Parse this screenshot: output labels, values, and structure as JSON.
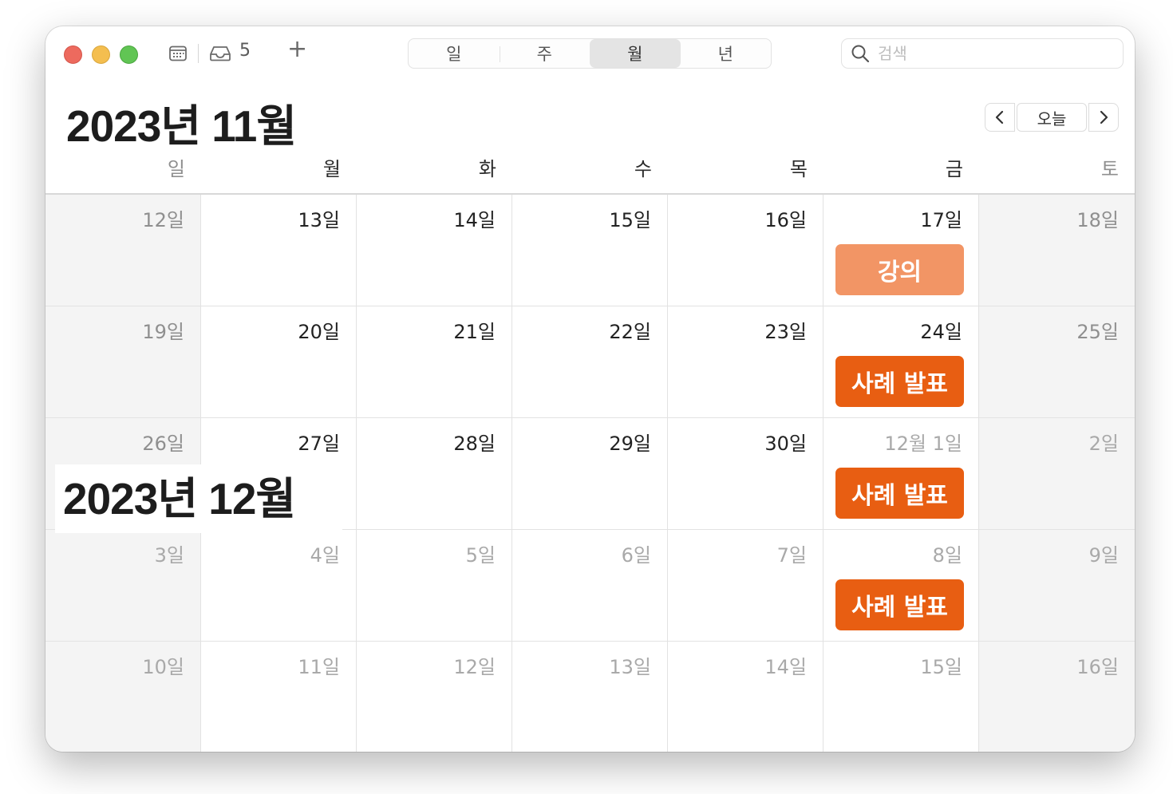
{
  "toolbar": {
    "inbox_count": "5",
    "add_label": "+",
    "view_tabs": [
      "일",
      "주",
      "월",
      "년"
    ],
    "active_view": "월",
    "search_placeholder": "검색"
  },
  "header": {
    "month_title": "2023년 11월",
    "today_label": "오늘"
  },
  "weekdays": [
    "일",
    "월",
    "화",
    "수",
    "목",
    "금",
    "토"
  ],
  "weeks": [
    [
      {
        "label": "12일"
      },
      {
        "label": "13일"
      },
      {
        "label": "14일"
      },
      {
        "label": "15일"
      },
      {
        "label": "16일"
      },
      {
        "label": "17일",
        "event": "강의",
        "event_color": "#f29565"
      },
      {
        "label": "18일"
      }
    ],
    [
      {
        "label": "19일"
      },
      {
        "label": "20일"
      },
      {
        "label": "21일"
      },
      {
        "label": "22일"
      },
      {
        "label": "23일"
      },
      {
        "label": "24일",
        "event": "사례 발표",
        "event_color": "#e85e12"
      },
      {
        "label": "25일"
      }
    ],
    [
      {
        "label": "26일"
      },
      {
        "label": "27일"
      },
      {
        "label": "28일"
      },
      {
        "label": "29일"
      },
      {
        "label": "30일"
      },
      {
        "label": "12월 1일",
        "other": true,
        "event": "사례 발표",
        "event_color": "#e85e12"
      },
      {
        "label": "2일",
        "other": true
      }
    ],
    [
      {
        "label": "3일",
        "other": true
      },
      {
        "label": "4일",
        "other": true
      },
      {
        "label": "5일",
        "other": true
      },
      {
        "label": "6일",
        "other": true
      },
      {
        "label": "7일",
        "other": true
      },
      {
        "label": "8일",
        "other": true,
        "event": "사례 발표",
        "event_color": "#e85e12"
      },
      {
        "label": "9일",
        "other": true
      }
    ],
    [
      {
        "label": "10일",
        "other": true
      },
      {
        "label": "11일",
        "other": true
      },
      {
        "label": "12일",
        "other": true
      },
      {
        "label": "13일",
        "other": true
      },
      {
        "label": "14일",
        "other": true
      },
      {
        "label": "15일",
        "other": true
      },
      {
        "label": "16일",
        "other": true
      }
    ]
  ],
  "overlay_month_title": "2023년 12월",
  "colors": {
    "close": "#ed6a5e",
    "minimize": "#f4be4f",
    "maximize": "#61c554",
    "event_light": "#f29565",
    "event_dark": "#e85e12"
  }
}
